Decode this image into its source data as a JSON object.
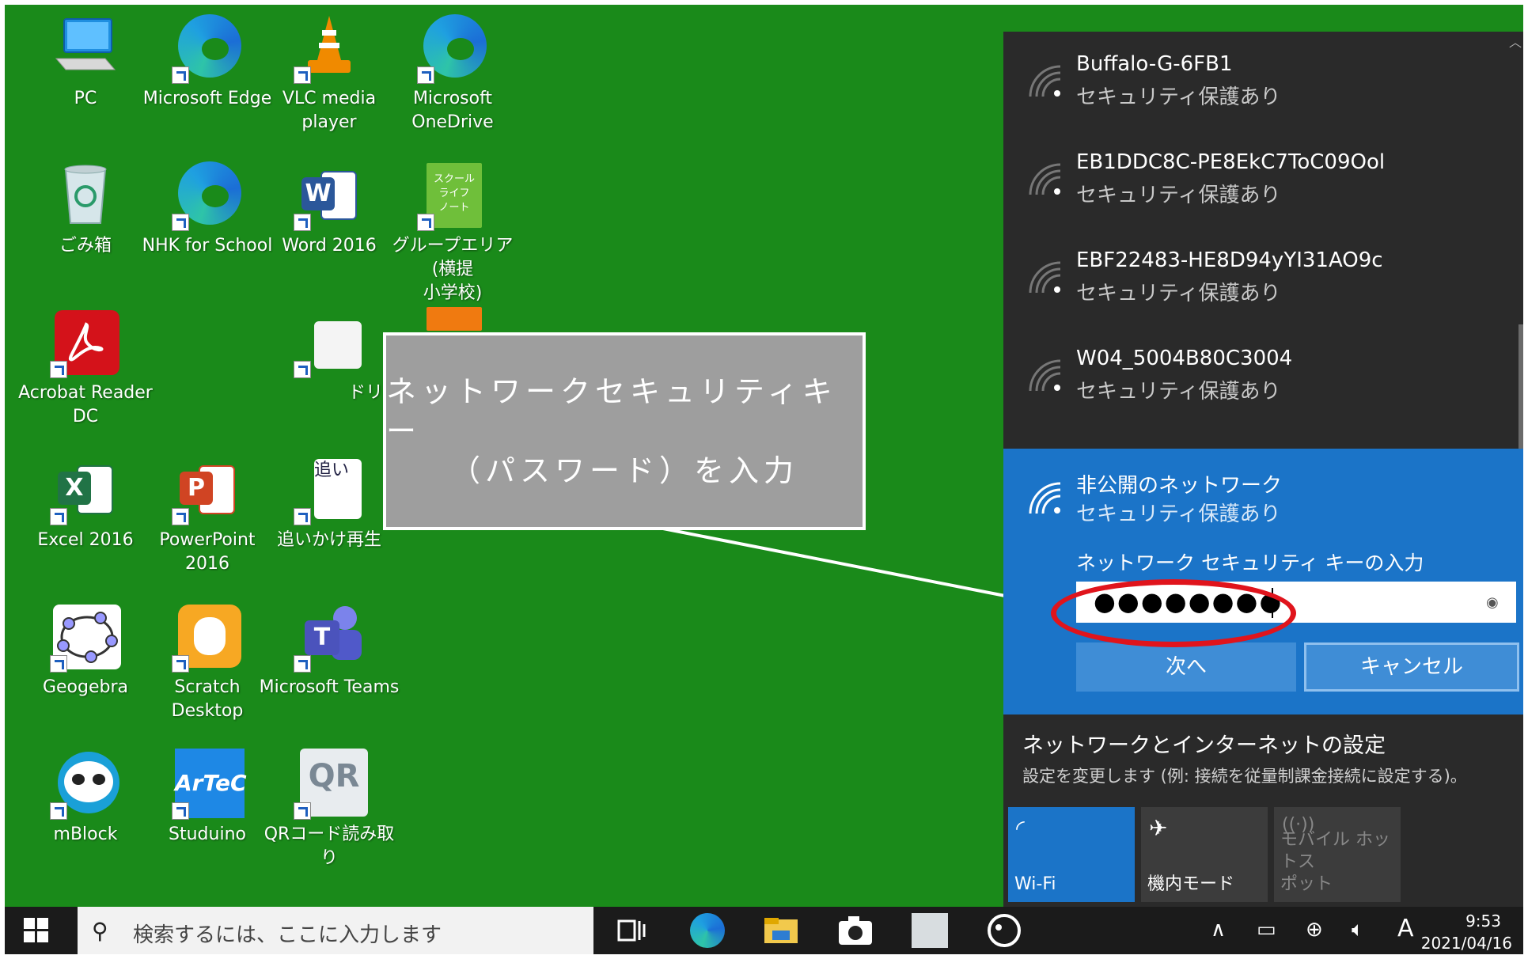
{
  "desktop": {
    "icons": [
      {
        "label": "PC"
      },
      {
        "label": "Microsoft Edge"
      },
      {
        "label": "VLC media player"
      },
      {
        "label": "Microsoft\nOneDrive"
      },
      {
        "label": "ごみ箱"
      },
      {
        "label": "NHK for School"
      },
      {
        "label": "Word 2016"
      },
      {
        "label": "グループエリア(横提\n小学校)"
      },
      {
        "label": "Acrobat Reader\nDC"
      },
      {
        "label": "ドリ"
      },
      {
        "label": "Excel 2016"
      },
      {
        "label": "PowerPoint 2016"
      },
      {
        "label": "追いかけ再生"
      },
      {
        "label": "Geogebra"
      },
      {
        "label": "Scratch Desktop"
      },
      {
        "label": "Microsoft Teams"
      },
      {
        "label": "mBlock"
      },
      {
        "label": "Studuino"
      },
      {
        "label": "QRコード読み取り"
      }
    ],
    "tile_text": {
      "word": "W",
      "excel": "X",
      "ppt": "P",
      "teams": "T",
      "artec": "ArTeC",
      "qr": "QR",
      "group": "スクール\nライフ\nノート",
      "oikake": "追い"
    }
  },
  "callout": {
    "line1": "ネットワークセキュリティキー",
    "line2": "（パスワード）を入力"
  },
  "network_flyout": {
    "networks": [
      {
        "name": "Buffalo-G-6FB1",
        "security": "セキュリティ保護あり"
      },
      {
        "name": "EB1DDC8C-PE8EkC7ToC09Ool",
        "security": "セキュリティ保護あり"
      },
      {
        "name": "EBF22483-HE8D94yYI31AO9c",
        "security": "セキュリティ保護あり"
      },
      {
        "name": "W04_5004B80C3004",
        "security": "セキュリティ保護あり"
      }
    ],
    "selected": {
      "name": "非公開のネットワーク",
      "security": "セキュリティ保護あり",
      "key_label": "ネットワーク セキュリティ キーの入力",
      "key_value": "●●●●●●●●",
      "next_label": "次へ",
      "cancel_label": "キャンセル"
    },
    "settings_title": "ネットワークとインターネットの設定",
    "settings_desc": "設定を変更します (例: 接続を従量制課金接続に設定する)。",
    "quick_actions": {
      "wifi": "Wi-Fi",
      "airplane": "機内モード",
      "mobile_hotspot": "モバイル ホットス\nポット"
    }
  },
  "taskbar": {
    "search_placeholder": "検索するには、ここに入力します",
    "ime": "A",
    "time": "9:53",
    "date": "2021/04/16"
  },
  "colors": {
    "desktop_bg": "#1a8a1a",
    "flyout_bg": "#2a2a2a",
    "accent": "#1b74c8",
    "highlight_oval": "#e0141c",
    "callout_bg": "#9e9e9e"
  }
}
